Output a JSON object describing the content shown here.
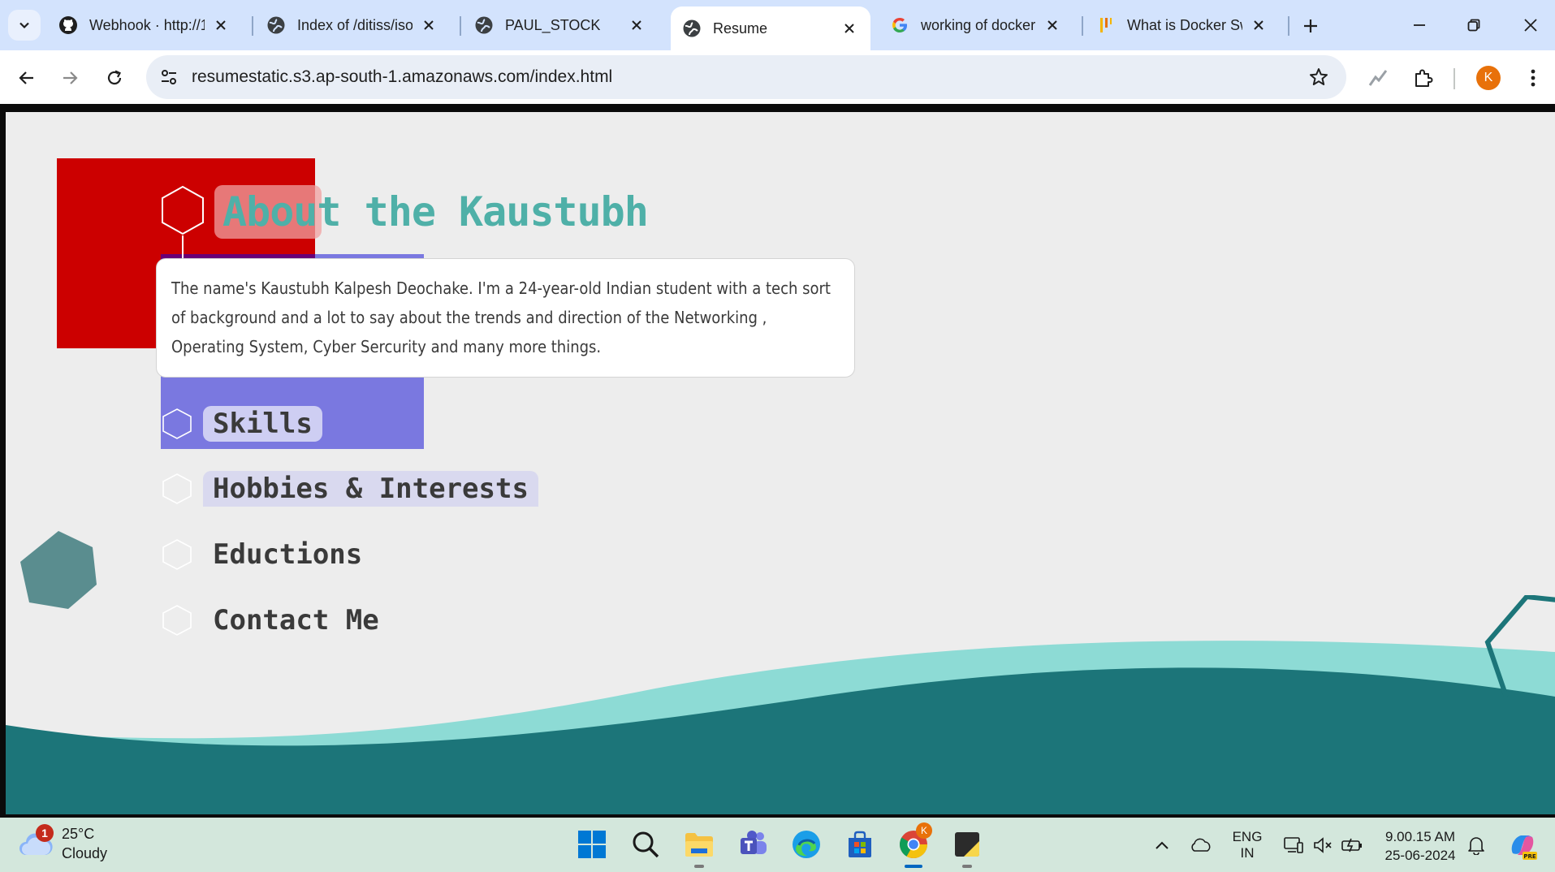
{
  "browser": {
    "tabs": [
      {
        "title": "Webhook · http://1",
        "icon": "github-icon",
        "active": false
      },
      {
        "title": "Index of /ditiss/iso",
        "icon": "globe-icon",
        "active": false
      },
      {
        "title": "PAUL_STOCK",
        "icon": "globe-icon",
        "active": false
      },
      {
        "title": "Resume",
        "icon": "globe-icon",
        "active": true
      },
      {
        "title": "working of docker",
        "icon": "google-icon",
        "active": false
      },
      {
        "title": "What is Docker Sw",
        "icon": "bar-icon",
        "active": false
      }
    ],
    "url": "resumestatic.s3.ap-south-1.amazonaws.com/index.html",
    "profile_initial": "K"
  },
  "page": {
    "heading": "About the Kaustubh",
    "about_text": "The name's Kaustubh Kalpesh Deochake. I'm a 24-year-old Indian student with a tech sort of background and a lot to say about the trends and direction of the Networking , Operating System, Cyber Sercurity and many more things.",
    "sections": [
      {
        "label": "Skills"
      },
      {
        "label": "Hobbies & Interests"
      },
      {
        "label": "Eductions"
      },
      {
        "label": "Contact Me"
      }
    ],
    "colors": {
      "heading": "#4fb0a8",
      "wave_light": "#8ddbd5",
      "wave_dark": "#1c7579",
      "red_block": "#cc0000",
      "purple_block": "#7a78e0",
      "hexagon_fill": "#5a8d8f"
    }
  },
  "taskbar": {
    "weather": {
      "temp": "25°C",
      "condition": "Cloudy",
      "badge": "1"
    },
    "language": {
      "line1": "ENG",
      "line2": "IN"
    },
    "clock": {
      "time": "9.00.15 AM",
      "date": "25-06-2024"
    },
    "chrome_badge": "K"
  }
}
